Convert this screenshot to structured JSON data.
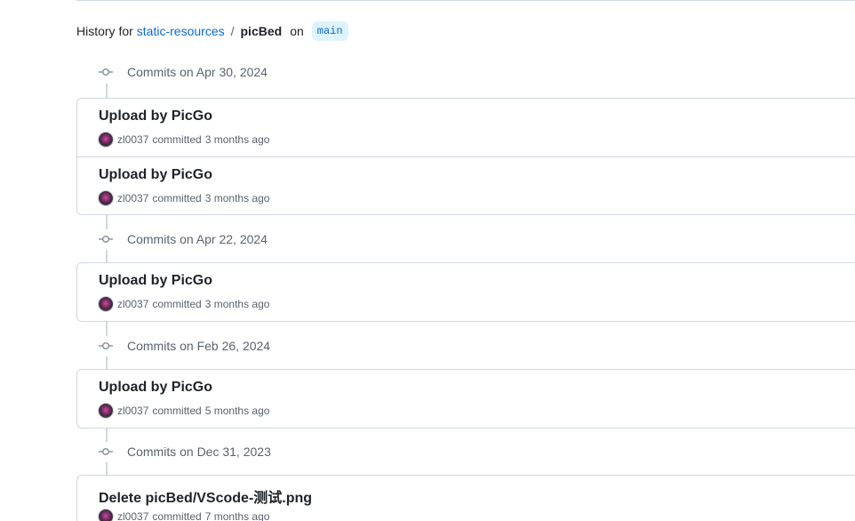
{
  "history": {
    "prefix": "History for",
    "repo": "static-resources",
    "separator": "/",
    "path": "picBed",
    "on": "on",
    "branch": "main"
  },
  "icons": {
    "commit_node": "git-commit-icon",
    "avatar": "user-avatar"
  },
  "colors": {
    "link": "#0969da",
    "branch_badge_bg": "#ddf4ff",
    "border": "#d0d7de",
    "muted": "#59636e"
  },
  "groups": [
    {
      "date": "Commits on Apr 30, 2024",
      "commits": [
        {
          "title": "Upload by PicGo",
          "author": "zl0037",
          "action": "committed",
          "time": "3 months ago"
        },
        {
          "title": "Upload by PicGo",
          "author": "zl0037",
          "action": "committed",
          "time": "3 months ago"
        }
      ]
    },
    {
      "date": "Commits on Apr 22, 2024",
      "commits": [
        {
          "title": "Upload by PicGo",
          "author": "zl0037",
          "action": "committed",
          "time": "3 months ago"
        }
      ]
    },
    {
      "date": "Commits on Feb 26, 2024",
      "commits": [
        {
          "title": "Upload by PicGo",
          "author": "zl0037",
          "action": "committed",
          "time": "5 months ago"
        }
      ]
    },
    {
      "date": "Commits on Dec 31, 2023",
      "commits": [
        {
          "title": "Delete picBed/VScode-测试.png",
          "author": "zl0037",
          "action": "committed",
          "time": "7 months ago"
        }
      ]
    }
  ]
}
